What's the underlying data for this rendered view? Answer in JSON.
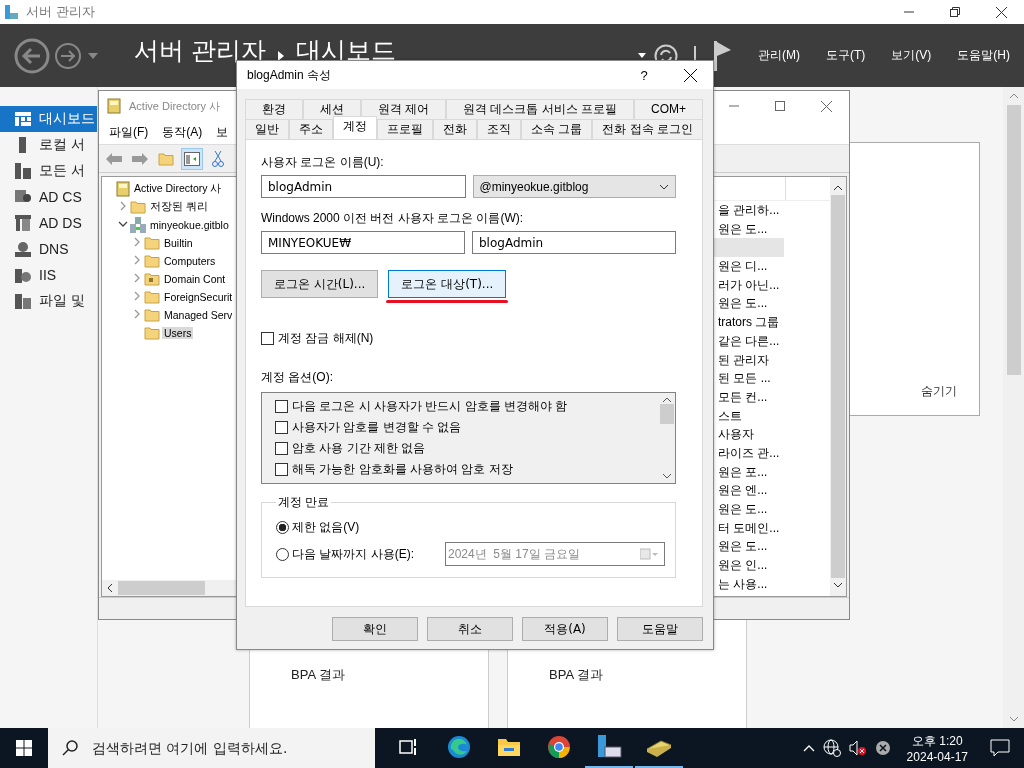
{
  "server_manager": {
    "title": "서버 관리자",
    "breadcrumb": [
      "서버 관리자",
      "대시보드"
    ],
    "menu": [
      "관리(M)",
      "도구(T)",
      "보기(V)",
      "도움말(H)"
    ],
    "sidebar": [
      {
        "label": "대시보드",
        "kind": "dashboard",
        "selected": true
      },
      {
        "label": "로컬 서",
        "kind": "local",
        "selected": false
      },
      {
        "label": "모든 서",
        "kind": "all",
        "selected": false
      },
      {
        "label": "AD CS",
        "kind": "adcs",
        "selected": false
      },
      {
        "label": "AD DS",
        "kind": "adds",
        "selected": false
      },
      {
        "label": "DNS",
        "kind": "dns",
        "selected": false
      },
      {
        "label": "IIS",
        "kind": "iis",
        "selected": false
      },
      {
        "label": "파일 및",
        "kind": "files",
        "selected": false
      }
    ],
    "hide_link": "숨기기",
    "tiles": [
      {
        "label": "BPA 결과"
      },
      {
        "label": "BPA 결과"
      }
    ]
  },
  "ad_window": {
    "title": "Active Directory 사",
    "menu": [
      "파일(F)",
      "동작(A)",
      "보"
    ],
    "tree": [
      {
        "label": "Active Directory 사",
        "kind": "root",
        "children": [
          {
            "label": "저장된 쿼리",
            "kind": "folder",
            "expanded": false
          },
          {
            "label": "minyeokue.gitblo",
            "kind": "domain",
            "expanded": true,
            "children": [
              {
                "label": "Builtin",
                "kind": "folder",
                "expanded": false
              },
              {
                "label": "Computers",
                "kind": "folder",
                "expanded": false
              },
              {
                "label": "Domain Cont",
                "kind": "ou",
                "expanded": false
              },
              {
                "label": "ForeignSecurit",
                "kind": "folder",
                "expanded": false
              },
              {
                "label": "Managed Serv",
                "kind": "folder",
                "expanded": false
              },
              {
                "label": "Users",
                "kind": "folder",
                "selected": true
              }
            ]
          }
        ]
      }
    ],
    "list_rows": [
      {
        "text": "을 관리하...",
        "selected": false
      },
      {
        "text": "원은 도...",
        "selected": false
      },
      {
        "text": "",
        "selected": true
      },
      {
        "text": "원은 디...",
        "selected": false
      },
      {
        "text": "러가 아닌...",
        "selected": false
      },
      {
        "text": "원은 도...",
        "selected": false
      },
      {
        "text": "trators 그룹",
        "selected": false
      },
      {
        "text": "같은 다른...",
        "selected": false
      },
      {
        "text": "된 관리자",
        "selected": false
      },
      {
        "text": "된 모든 ...",
        "selected": false
      },
      {
        "text": "모든 컨...",
        "selected": false
      },
      {
        "text": "스트",
        "selected": false
      },
      {
        "text": "사용자",
        "selected": false
      },
      {
        "text": "라이즈 관...",
        "selected": false
      },
      {
        "text": "원은 포...",
        "selected": false
      },
      {
        "text": "원은 엔...",
        "selected": false
      },
      {
        "text": "원은 도...",
        "selected": false
      },
      {
        "text": "터 도메인...",
        "selected": false
      },
      {
        "text": "원은 도...",
        "selected": false
      },
      {
        "text": "원은 인...",
        "selected": false
      },
      {
        "text": "는 사용...",
        "selected": false
      }
    ]
  },
  "dialog": {
    "title": "blogAdmin 속성",
    "help": "?",
    "tab_rows": [
      [
        {
          "label": "환경",
          "selected": false
        },
        {
          "label": "세션",
          "selected": false
        },
        {
          "label": "원격 제어",
          "selected": false
        },
        {
          "label": "원격 데스크톱 서비스 프로필",
          "selected": false
        },
        {
          "label": "COM+",
          "selected": false
        }
      ],
      [
        {
          "label": "일반",
          "selected": false
        },
        {
          "label": "주소",
          "selected": false
        },
        {
          "label": "계정",
          "selected": true
        },
        {
          "label": "프로필",
          "selected": false
        },
        {
          "label": "전화",
          "selected": false
        },
        {
          "label": "조직",
          "selected": false
        },
        {
          "label": "소속 그룹",
          "selected": false
        },
        {
          "label": "전화 접속 로그인",
          "selected": false
        }
      ]
    ],
    "logon_label": "사용자 로그온 이름(U):",
    "logon_name": "blogAdmin",
    "domain": "@minyeokue.gitblog",
    "legacy_label": "Windows 2000 이전 버전 사용자 로그온 이름(W):",
    "legacy_domain": "MINYEOKUE₩",
    "legacy_name": "blogAdmin",
    "logon_buttons": [
      {
        "label": "로그온 시간(L)...",
        "focused": false,
        "underlined": false
      },
      {
        "label": "로그온 대상(T)...",
        "focused": true,
        "underlined": true
      }
    ],
    "unlock": {
      "label": "계정 잠금 해제(N)",
      "checked": false
    },
    "options_label": "계정 옵션(O):",
    "options": [
      {
        "label": "다음 로그온 시 사용자가 반드시 암호를 변경해야 함",
        "checked": false
      },
      {
        "label": "사용자가 암호를 변경할 수 없음",
        "checked": false
      },
      {
        "label": "암호 사용 기간 제한 없음",
        "checked": false
      },
      {
        "label": "해독 가능한 암호화를 사용하여 암호 저장",
        "checked": false
      }
    ],
    "expiry": {
      "title": "계정 만료",
      "choices": [
        {
          "label": "제한 없음(V)",
          "selected": true
        },
        {
          "label": "다음 날짜까지 사용(E):",
          "selected": false
        }
      ],
      "date": "2024년  5월 17일 금요일",
      "date_disabled": true
    },
    "buttons": [
      "확인",
      "취소",
      "적용(A)",
      "도움말"
    ]
  },
  "taskbar": {
    "search_placeholder": "검색하려면 여기에 입력하세요.",
    "apps": [
      {
        "kind": "taskview",
        "running": false
      },
      {
        "kind": "edge",
        "running": false
      },
      {
        "kind": "explorer",
        "running": false
      },
      {
        "kind": "chrome",
        "running": false
      },
      {
        "kind": "servermanager",
        "running": true
      },
      {
        "kind": "adtool",
        "running": true
      }
    ],
    "time": "오후 1:20",
    "date": "2024-04-17"
  }
}
